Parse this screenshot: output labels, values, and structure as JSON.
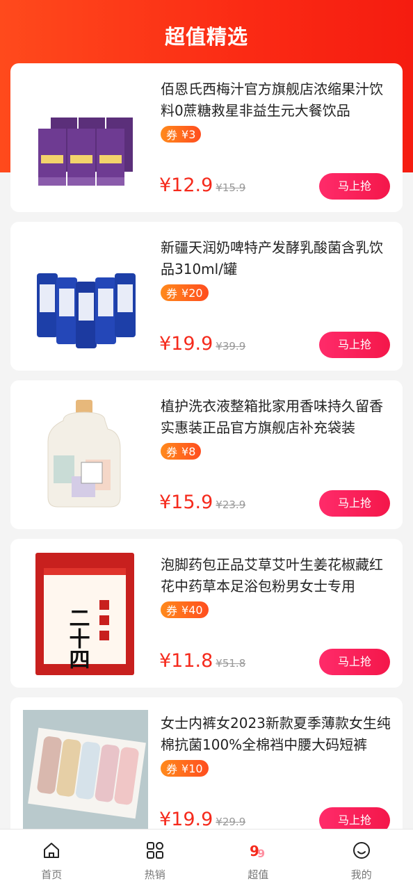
{
  "header": {
    "title": "超值精选"
  },
  "colors": {
    "brand": "#f52a1c",
    "button": "#f4174a",
    "coupon": "#ff6a1e"
  },
  "products": [
    {
      "title": "佰恩氏西梅汁官方旗舰店浓缩果汁饮料0蔗糖救星非益生元大餐饮品",
      "coupon_tag": "券",
      "coupon_value": "¥3",
      "price": "¥12.9",
      "original_price": "¥15.9",
      "buy_label": "马上抢",
      "image": "prune-juice-boxes"
    },
    {
      "title": "新疆天润奶啤特产发酵乳酸菌含乳饮品310ml/罐",
      "coupon_tag": "券",
      "coupon_value": "¥20",
      "price": "¥19.9",
      "original_price": "¥39.9",
      "buy_label": "马上抢",
      "image": "milk-beer-cans"
    },
    {
      "title": "植护洗衣液整箱批家用香味持久留香实惠装正品官方旗舰店补充袋装",
      "coupon_tag": "券",
      "coupon_value": "¥8",
      "price": "¥15.9",
      "original_price": "¥23.9",
      "buy_label": "马上抢",
      "image": "laundry-detergent-bottle"
    },
    {
      "title": "泡脚药包正品艾草艾叶生姜花椒藏红花中药草本足浴包粉男女士专用",
      "coupon_tag": "券",
      "coupon_value": "¥40",
      "price": "¥11.8",
      "original_price": "¥51.8",
      "buy_label": "马上抢",
      "image": "foot-bath-pack",
      "image_text": "二十四"
    },
    {
      "title": "女士内裤女2023新款夏季薄款女生纯棉抗菌100%全棉裆中腰大码短裤",
      "coupon_tag": "券",
      "coupon_value": "¥10",
      "price": "¥19.9",
      "original_price": "¥29.9",
      "buy_label": "马上抢",
      "image": "underwear-box"
    }
  ],
  "tabbar": {
    "items": [
      {
        "label": "首页",
        "icon": "home-icon"
      },
      {
        "label": "热销",
        "icon": "grid-icon"
      },
      {
        "label": "超值",
        "icon": "nine-nine-icon"
      },
      {
        "label": "我的",
        "icon": "smile-icon"
      }
    ]
  }
}
